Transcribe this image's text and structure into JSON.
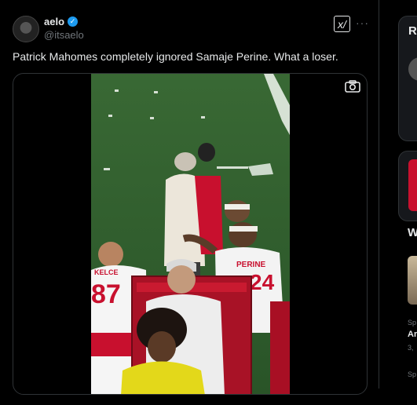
{
  "tweet": {
    "author_name": "aelo",
    "author_handle": "@itsaelo",
    "text": "Patrick Mahomes completely ignored Samaje Perine.  What a loser.",
    "grok_label": "x/",
    "more_label": "···",
    "media": {
      "jersey_left": "KELCE",
      "jersey_left_number": "87",
      "jersey_right": "PERINE",
      "jersey_right_number": "24"
    }
  },
  "sidebar": {
    "card1_title_fragment": "R",
    "card3_title_fragment": "W",
    "item1_label_fragment": "Sp",
    "item1_title_fragment": "Ar",
    "item1_count_fragment": "3,",
    "item2_label_fragment": "Sp"
  },
  "colors": {
    "accent": "#1d9bf0",
    "chiefs_red": "#c8102e",
    "field_green": "#2f5f2c"
  },
  "icons": {
    "verified": "verified-badge-icon",
    "grok": "grok-icon",
    "more": "more-icon",
    "camera": "camera-icon"
  }
}
